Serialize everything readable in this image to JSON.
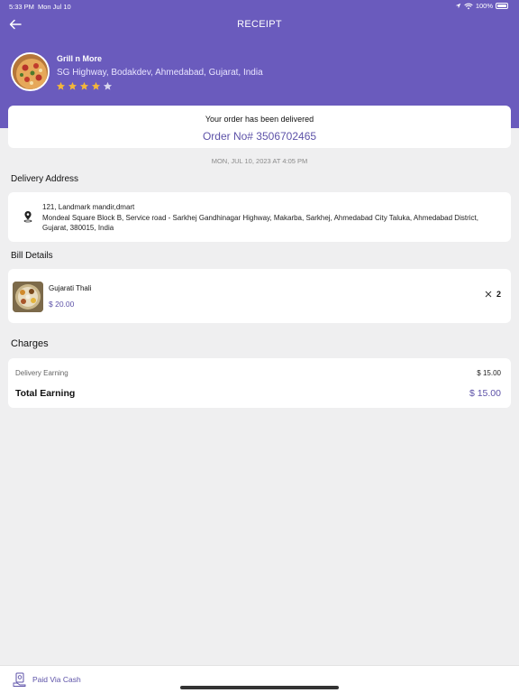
{
  "status_bar": {
    "time": "5:33 PM",
    "date": "Mon Jul 10",
    "battery": "100%"
  },
  "header": {
    "title": "RECEIPT"
  },
  "restaurant": {
    "name": "Grill n More",
    "address": "SG Highway, Bodakdev, Ahmedabad, Gujarat, India",
    "rating": 4,
    "rating_max": 5
  },
  "order": {
    "status_text": "Your order has been delivered",
    "order_number": "Order No# 3506702465",
    "date": "MON, JUL 10, 2023 AT 4:05 PM"
  },
  "delivery_address": {
    "section_title": "Delivery Address",
    "line1": "121, Landmark mandir,dmart",
    "line2": "Mondeal Square Block B, Service road - Sarkhej Gandhinagar Highway, Makarba, Sarkhej, Ahmedabad City Taluka, Ahmedabad District, Gujarat, 380015, India"
  },
  "bill": {
    "section_title": "Bill Details",
    "items": [
      {
        "name": "Gujarati Thali",
        "price": "$ 20.00",
        "quantity": "2"
      }
    ]
  },
  "charges": {
    "section_title": "Charges",
    "delivery_label": "Delivery Earning",
    "delivery_value": "$ 15.00",
    "total_label": "Total Earning",
    "total_value": "$ 15.00"
  },
  "payment": {
    "label": "Paid Via Cash"
  },
  "colors": {
    "brand": "#6a5bbd",
    "accent_text": "#5d52a8",
    "star": "#f3b63a",
    "star_empty": "#d9d6ee"
  },
  "icons": [
    "back-arrow-icon",
    "wifi-icon",
    "location-arrow-icon",
    "battery-icon",
    "star-icon",
    "location-pin-icon",
    "close-icon",
    "cash-icon"
  ]
}
